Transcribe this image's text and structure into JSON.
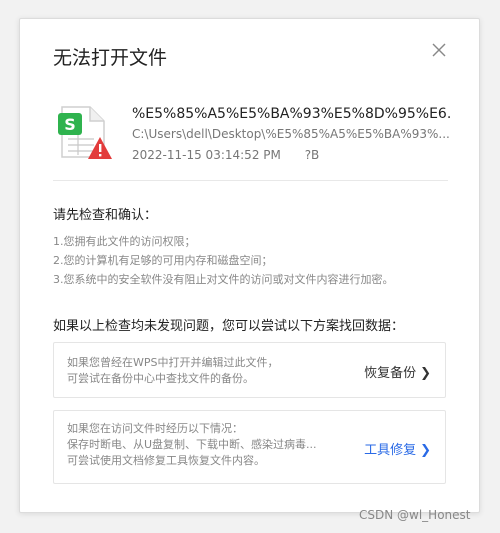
{
  "dialog": {
    "title": "无法打开文件",
    "file": {
      "name": "%E5%85%A5%E5%BA%93%E5%8D%95%E6...",
      "path": "C:\\Users\\dell\\Desktop\\%E5%85%A5%E5%BA%93%...",
      "date": "2022-11-15  03:14:52 PM",
      "size": "?B",
      "icon": "wps-spreadsheet-error-icon"
    },
    "check_title": "请先检查和确认：",
    "check_items": [
      "1.您拥有此文件的访问权限；",
      "2.您的计算机有足够的可用内存和磁盘空间；",
      "3.您系统中的安全软件没有阻止对文件的访问或对文件内容进行加密。"
    ],
    "recover_title": "如果以上检查均未发现问题，您可以尝试以下方案找回数据：",
    "options": [
      {
        "lines": [
          "如果您曾经在WPS中打开并编辑过此文件，",
          "可尝试在备份中心中查找文件的备份。"
        ],
        "action": "恢复备份"
      },
      {
        "lines": [
          "如果您在访问文件时经历以下情况：",
          "保存时断电、从U盘复制、下载中断、感染过病毒...",
          "可尝试使用文档修复工具恢复文件内容。"
        ],
        "action": "工具修复"
      }
    ],
    "colors": {
      "link": "#2a6ae6",
      "icon_green": "#2fb34e",
      "warning_red": "#e23b3b"
    }
  },
  "watermark": "CSDN @wl_Honest"
}
